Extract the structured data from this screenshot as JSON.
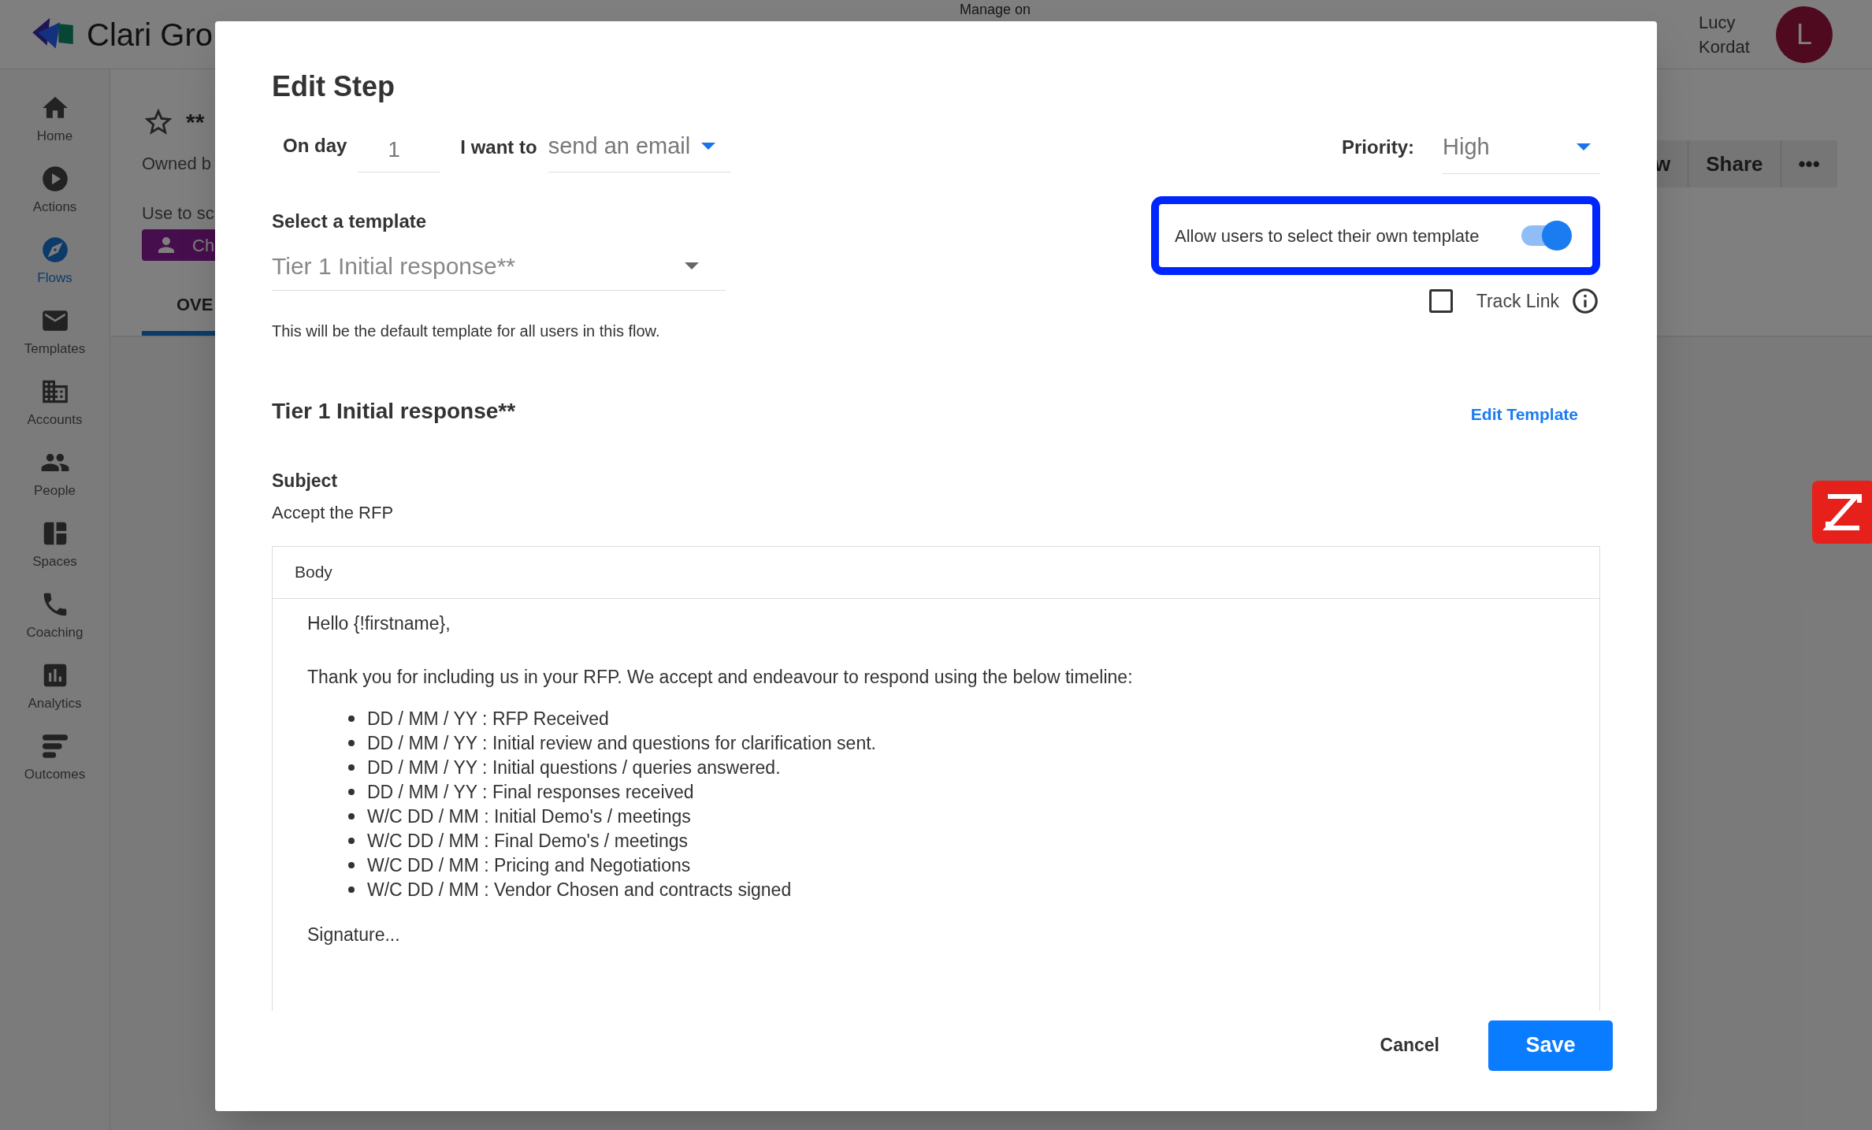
{
  "app": {
    "logo_text": "Clari Gro",
    "top_notice": "Manage on",
    "user": {
      "name": "Lucy Kordat",
      "initial": "L"
    }
  },
  "sidebar": {
    "items": [
      {
        "label": "Home",
        "selected": false
      },
      {
        "label": "Actions",
        "selected": false
      },
      {
        "label": "Flows",
        "selected": true
      },
      {
        "label": "Templates",
        "selected": false
      },
      {
        "label": "Accounts",
        "selected": false
      },
      {
        "label": "People",
        "selected": false
      },
      {
        "label": "Spaces",
        "selected": false
      },
      {
        "label": "Coaching",
        "selected": false
      },
      {
        "label": "Analytics",
        "selected": false
      },
      {
        "label": "Outcomes",
        "selected": false
      }
    ]
  },
  "page": {
    "title": "**",
    "owner": "Owned b",
    "description": "Use to sc",
    "chip": "Ch",
    "tabs": [
      {
        "label": "OVE",
        "selected": true
      }
    ],
    "actions": [
      "w",
      "Share",
      "•••"
    ]
  },
  "modal": {
    "title": "Edit Step",
    "day_label": "On day",
    "day_value": "1",
    "action_label": "I want to",
    "action_value": "send an email",
    "priority_label": "Priority:",
    "priority_value": "High",
    "template_label": "Select a template",
    "template_value": "Tier 1 Initial response**",
    "allow_own_template": {
      "label": "Allow users to select their own template",
      "on": true,
      "highlighted": true
    },
    "track_link": {
      "label": "Track Link",
      "checked": false
    },
    "hint": "This will be the default template for all users in this flow.",
    "template_name": "Tier 1 Initial response**",
    "edit_template": "Edit Template",
    "subject_label": "Subject",
    "subject_value": "Accept the RFP",
    "body_label": "Body",
    "body": {
      "greeting": "Hello {!firstname},",
      "intro": "Thank you for including us in your RFP. We accept and endeavour to respond using the below timeline:",
      "bullets": [
        "DD / MM / YY : RFP Received",
        "DD / MM / YY : Initial review and questions for clarification sent.",
        "DD / MM / YY : Initial questions / queries answered.",
        "DD / MM / YY : Final responses received",
        "W/C DD / MM : Initial Demo's / meetings",
        "W/C DD / MM : Final Demo's / meetings",
        "W/C DD / MM : Pricing and Negotiations",
        "W/C DD / MM : Vendor Chosen and contracts signed"
      ],
      "closing": "Signature..."
    },
    "cancel": "Cancel",
    "save": "Save"
  }
}
